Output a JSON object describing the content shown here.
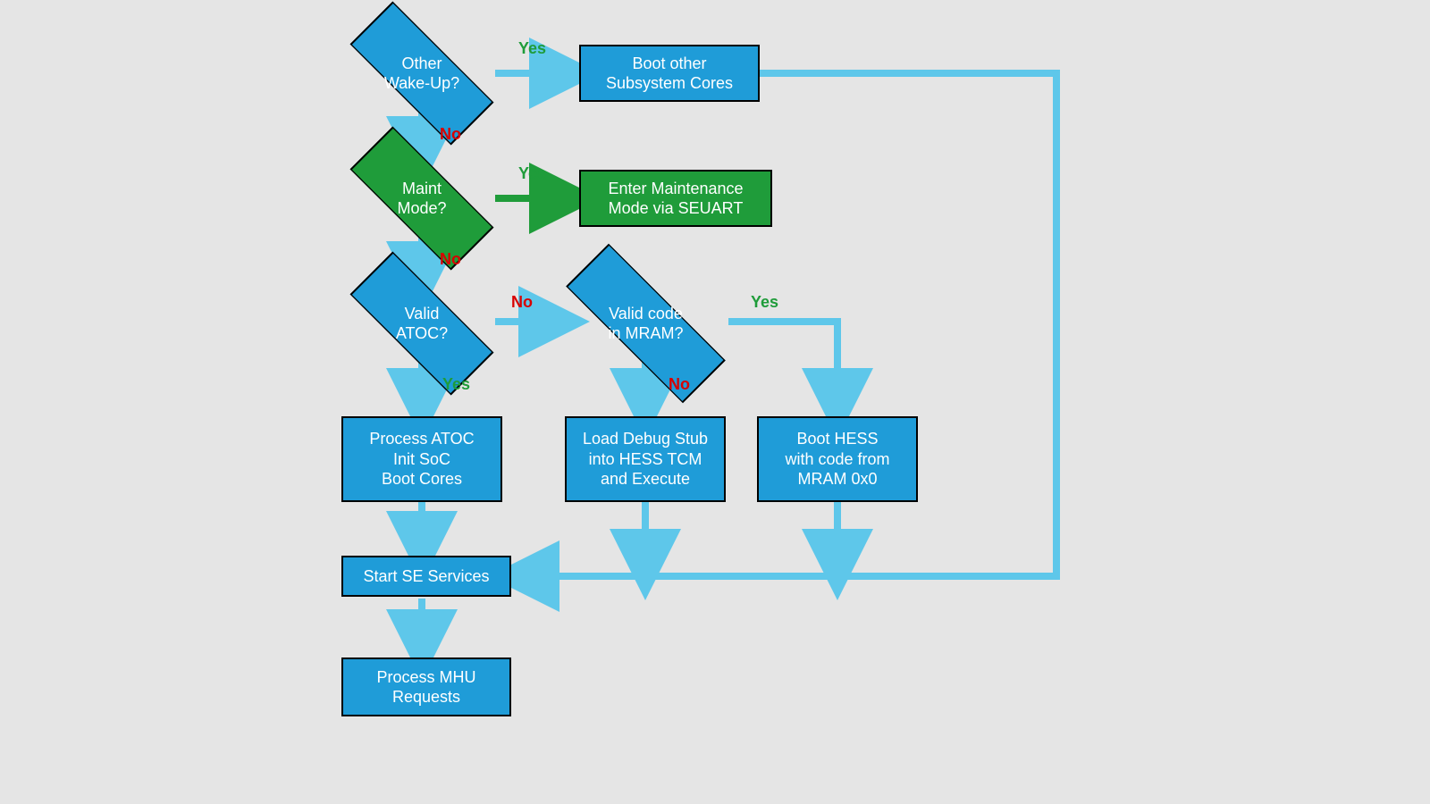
{
  "nodes": {
    "other_wakeup": {
      "line1": "Other",
      "line2": "Wake-Up?"
    },
    "boot_other": {
      "line1": "Boot other",
      "line2": "Subsystem Cores"
    },
    "maint_mode": {
      "line1": "Maint",
      "line2": "Mode?"
    },
    "enter_maint": {
      "line1": "Enter Maintenance",
      "line2": "Mode via SEUART"
    },
    "valid_atoc": {
      "line1": "Valid",
      "line2": "ATOC?"
    },
    "valid_code_mram": {
      "line1": "Valid code",
      "line2": "in MRAM?"
    },
    "process_atoc": {
      "line1": "Process ATOC",
      "line2": "Init SoC",
      "line3": "Boot Cores"
    },
    "load_debug": {
      "line1": "Load Debug Stub",
      "line2": "into HESS TCM",
      "line3": "and Execute"
    },
    "boot_hess": {
      "line1": "Boot HESS",
      "line2": "with code from",
      "line3": "MRAM 0x0"
    },
    "start_se": {
      "line1": "Start SE Services"
    },
    "process_mhu": {
      "line1": "Process MHU",
      "line2": "Requests"
    }
  },
  "edges": {
    "wakeup_yes": "Yes",
    "wakeup_no": "No",
    "maint_yes": "Yes",
    "maint_no": "No",
    "atoc_no": "No",
    "atoc_yes": "Yes",
    "mram_yes": "Yes",
    "mram_no": "No"
  },
  "colors": {
    "blue": "#1f9cd8",
    "green": "#1f9c3a",
    "arrow_blue": "#5ec7ea",
    "arrow_green": "#1f9c3a",
    "yes_text": "#1f9c3a",
    "no_text": "#d80000"
  }
}
